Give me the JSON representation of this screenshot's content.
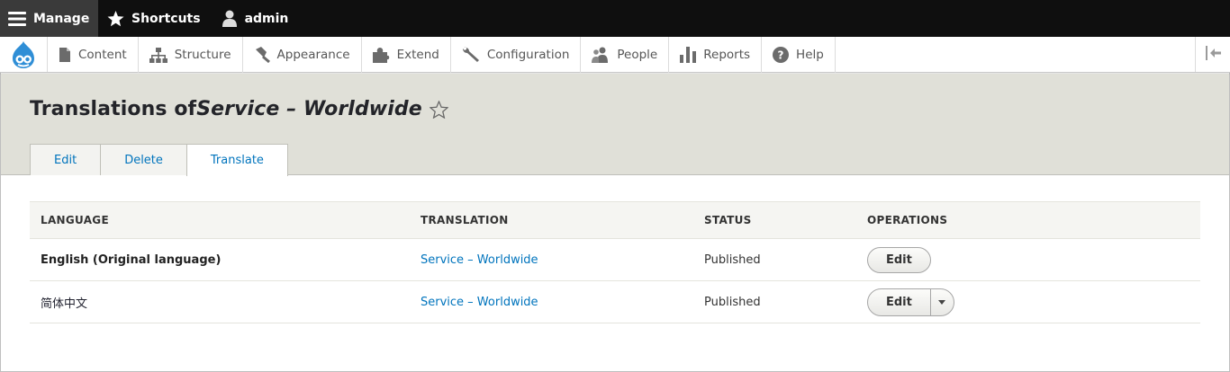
{
  "toolbar": {
    "manage_label": "Manage",
    "shortcuts_label": "Shortcuts",
    "user_label": "admin"
  },
  "tray": {
    "items": [
      {
        "label": "Content",
        "icon": "document-icon"
      },
      {
        "label": "Structure",
        "icon": "sitemap-icon"
      },
      {
        "label": "Appearance",
        "icon": "paintbrush-icon"
      },
      {
        "label": "Extend",
        "icon": "puzzle-icon"
      },
      {
        "label": "Configuration",
        "icon": "wrench-icon"
      },
      {
        "label": "People",
        "icon": "people-icon"
      },
      {
        "label": "Reports",
        "icon": "bar-chart-icon"
      },
      {
        "label": "Help",
        "icon": "help-icon"
      }
    ]
  },
  "page": {
    "title_prefix": "Translations of ",
    "title_node": "Service – Worldwide"
  },
  "tabs": [
    {
      "label": "Edit",
      "active": false
    },
    {
      "label": "Delete",
      "active": false
    },
    {
      "label": "Translate",
      "active": true
    }
  ],
  "table": {
    "headers": [
      "LANGUAGE",
      "TRANSLATION",
      "STATUS",
      "OPERATIONS"
    ],
    "rows": [
      {
        "language": "English (Original language)",
        "translation": "Service – Worldwide",
        "status": "Published",
        "operation": "Edit",
        "has_dropdown": false
      },
      {
        "language": "简体中文",
        "translation": "Service – Worldwide",
        "status": "Published",
        "operation": "Edit",
        "has_dropdown": true
      }
    ]
  },
  "colors": {
    "link": "#0074bd",
    "toolbar_bg": "#0f0f0f",
    "header_bg": "#e0e0d8"
  }
}
